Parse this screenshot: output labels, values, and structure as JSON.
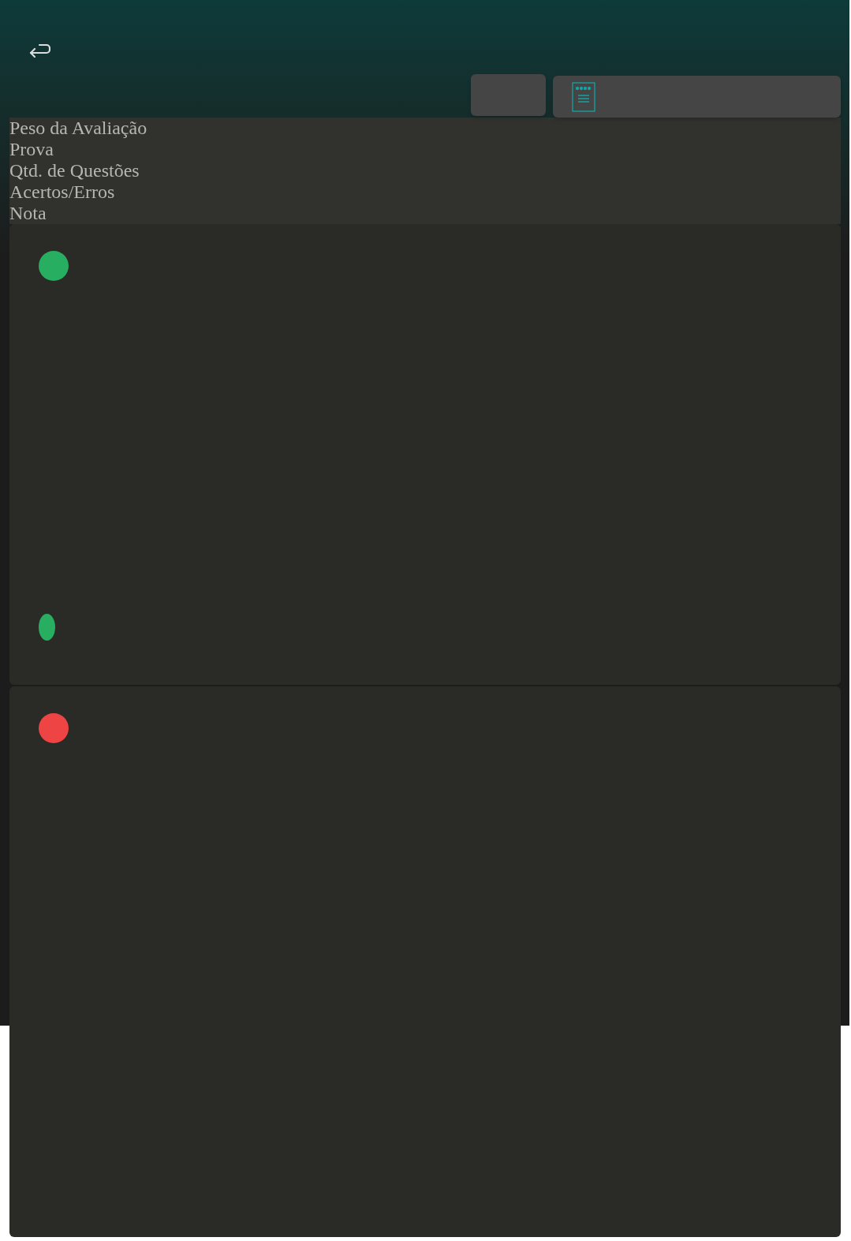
{
  "summary_labels": [
    "Peso da Avaliação",
    "Prova",
    "Qtd. de Questões",
    "Acertos/Erros",
    "Nota"
  ],
  "cards": [
    {
      "color": "#27ae60",
      "marker": true
    },
    {
      "color": "#ef4444",
      "marker": false
    }
  ]
}
